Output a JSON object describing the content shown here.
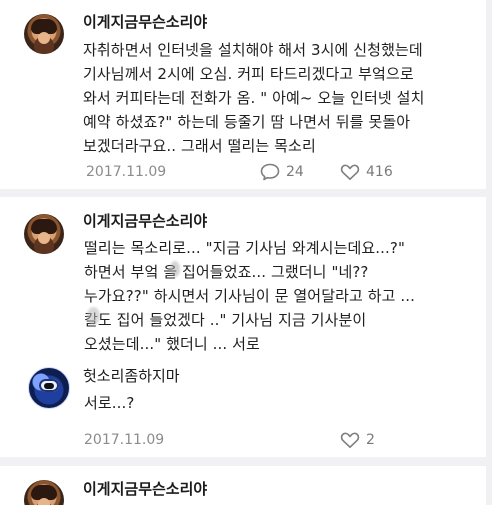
{
  "posts": [
    {
      "username": "이게지금무슨소리야",
      "text": "자취하면서 인터넷을 설치해야 해서 3시에 신청했는데\n기사님께서 2시에 오심. 커피 타드리겠다고 부엌으로\n와서 커피타는데 전화가 옴. \" 아예~ 오늘 인터넷 설치\n예약 하셨죠?\" 하는데 등줄기 땀 나면서 뒤를 못돌아\n보겠더라구요.. 그래서 떨리는 목소리",
      "date": "2017.11.09",
      "comments": "24",
      "likes": "416"
    },
    {
      "username": "이게지금무슨소리야",
      "text": "떨리는 목소리로... \"지금 기사님 와계시는데요...?\"\n하면서 부엌  을 집어들었죠... 그랬더니 \"네??\n누가요??\" 하시면서 기사님이 문 열어달라고 하고 ...\n  칼도 집어 들었겠다 ..\" 기사님 지금 기사분이\n오셨는데...\" 했더니 ... 서로"
    },
    {
      "username": "헛소리좀하지마",
      "text": "서로...?",
      "date": "2017.11.09",
      "likes": "2"
    },
    {
      "username": "이게지금무슨소리야"
    }
  ],
  "icons": {
    "comment": "comment-icon",
    "heart": "heart-icon",
    "expand": "expand-icon"
  }
}
